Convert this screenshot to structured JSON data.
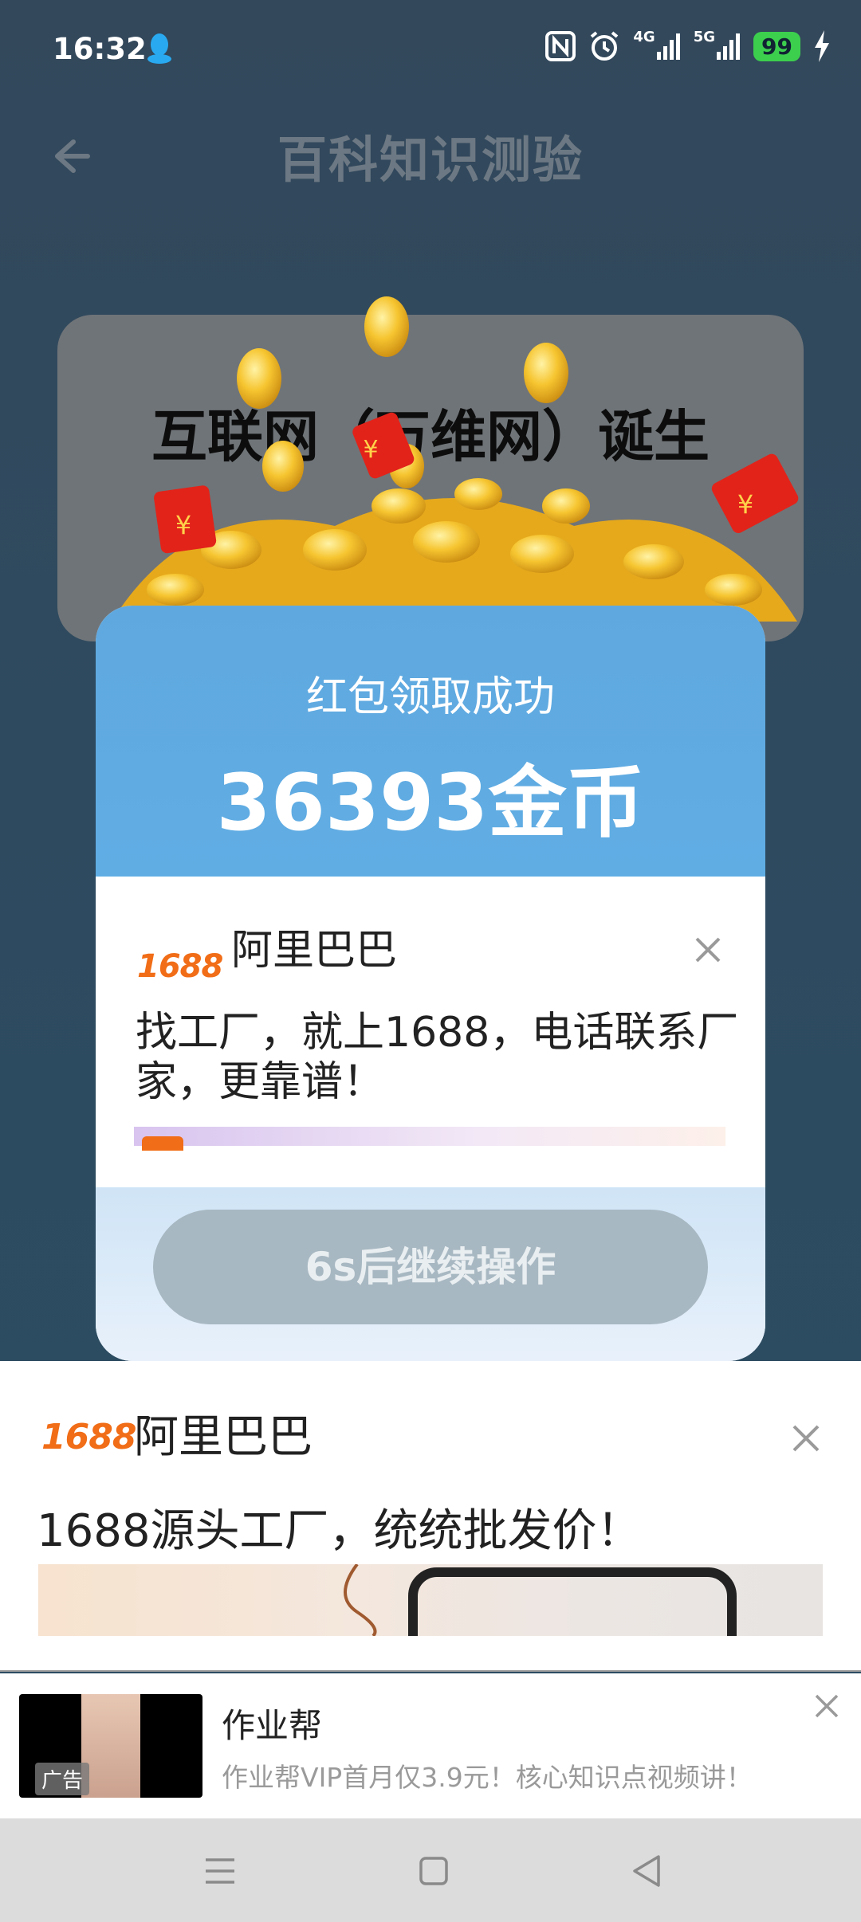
{
  "status_bar": {
    "time": "16:32",
    "signal_1": "4G",
    "signal_2": "5G",
    "battery": "99"
  },
  "header": {
    "title": "百科知识测验"
  },
  "quiz": {
    "question": "互联网（万维网）诞生"
  },
  "reward_modal": {
    "subtitle": "红包领取成功",
    "coins": "36393金币",
    "ad": {
      "logo": "1688",
      "brand": "阿里巴巴",
      "description": "找工厂，就上1688，电话联系厂家，更靠谱！"
    },
    "wait_button": "6s后继续操作"
  },
  "bottom_ad": {
    "logo": "1688",
    "brand": "阿里巴巴",
    "description": "1688源头工厂，统统批发价！"
  },
  "banner_ad": {
    "tag": "广告",
    "title": "作业帮",
    "description": "作业帮VIP首月仅3.9元！核心知识点视频讲！"
  },
  "colors": {
    "accent_orange": "#f16d17",
    "modal_blue": "#5fa8df",
    "battery_green": "#3ccf4e"
  },
  "icons": [
    "qq-icon",
    "nfc-icon",
    "alarm-icon",
    "signal-icon",
    "charging-icon",
    "back-arrow-icon",
    "close-icon",
    "menu-icon",
    "home-icon",
    "back-icon",
    "red-envelope-icon",
    "coin-icon"
  ]
}
